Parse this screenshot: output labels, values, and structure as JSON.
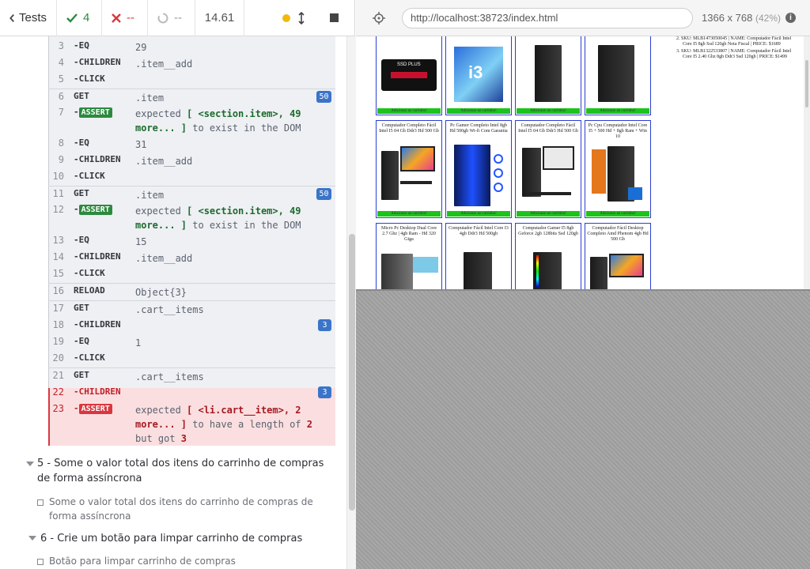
{
  "topbar": {
    "tests_label": "Tests",
    "passed": "4",
    "failed": "--",
    "pending": "--",
    "duration": "14.61"
  },
  "aut": {
    "url": "http://localhost:38723/index.html",
    "viewport": "1366 x 768",
    "scale": "(42%)"
  },
  "commands": [
    {
      "n": "3",
      "name": "-EQ",
      "msg": "29"
    },
    {
      "n": "4",
      "name": "-CHILDREN",
      "msg": ".item__add"
    },
    {
      "n": "5",
      "name": "-CLICK",
      "msg": ""
    },
    {
      "n": "6",
      "name": "GET",
      "msg": ".item",
      "badge": "50"
    },
    {
      "n": "7",
      "name": "ASSERT",
      "msg_a": "expected ",
      "msg_b": "[ <section.item>, 49 more... ]",
      "msg_c": " to exist in the DOM"
    },
    {
      "n": "8",
      "name": "-EQ",
      "msg": "31"
    },
    {
      "n": "9",
      "name": "-CHILDREN",
      "msg": ".item__add"
    },
    {
      "n": "10",
      "name": "-CLICK",
      "msg": ""
    },
    {
      "n": "11",
      "name": "GET",
      "msg": ".item",
      "badge": "50"
    },
    {
      "n": "12",
      "name": "ASSERT",
      "msg_a": "expected ",
      "msg_b": "[ <section.item>, 49 more... ]",
      "msg_c": " to exist in the DOM"
    },
    {
      "n": "13",
      "name": "-EQ",
      "msg": "15"
    },
    {
      "n": "14",
      "name": "-CHILDREN",
      "msg": ".item__add"
    },
    {
      "n": "15",
      "name": "-CLICK",
      "msg": ""
    },
    {
      "n": "16",
      "name": "RELOAD",
      "msg": "Object{3}"
    },
    {
      "n": "17",
      "name": "GET",
      "msg": ".cart__items"
    },
    {
      "n": "18",
      "name": "-CHILDREN",
      "msg": "",
      "badge": "3"
    },
    {
      "n": "19",
      "name": "-EQ",
      "msg": "1"
    },
    {
      "n": "20",
      "name": "-CLICK",
      "msg": ""
    },
    {
      "n": "21",
      "name": "GET",
      "msg": ".cart__items"
    },
    {
      "n": "22",
      "name": "-CHILDREN",
      "msg": "",
      "badge": "3"
    },
    {
      "n": "23",
      "name": "ASSERT",
      "msg_a": "expected ",
      "msg_b": "[ <li.cart__item>, 2 more... ]",
      "msg_c": " to have a length of ",
      "msg_d": "2",
      "msg_e": "but got ",
      "msg_f": "3"
    }
  ],
  "suites": [
    {
      "title": "5 - Some o valor total dos itens do carrinho de compras de forma assíncrona",
      "test": "Some o valor total dos itens do carrinho de compras de forma assíncrona"
    },
    {
      "title": "6 - Crie um botão para limpar carrinho de compras",
      "test": "Botão para limpar carrinho de compras"
    }
  ],
  "products": [
    {
      "title": "",
      "btn": "Adicionar ao carrinho!"
    },
    {
      "title": "",
      "btn": "Adicionar ao carrinho!"
    },
    {
      "title": "",
      "btn": "Adicionar ao carrinho!"
    },
    {
      "title": "",
      "btn": "Adicionar ao carrinho!"
    },
    {
      "title": "Computador Completo Fácil Intel I5 04 Gb Ddr3 Hd 500 Gb",
      "btn": "Adicionar ao carrinho!"
    },
    {
      "title": "Pc Gamer Completo Intel 8gb Hd 500gb Wi-fi Com Garantia",
      "btn": "Adicionar ao carrinho!"
    },
    {
      "title": "Computador Completo Fácil Intel I5 04 Gb Ddr3 Hd 500 Gb",
      "btn": "Adicionar ao carrinho!"
    },
    {
      "title": "Pc Cpu Computador Intel Core I5 + 500 Hd + 8gb Ram + Win 10",
      "btn": "Adicionar ao carrinho!"
    },
    {
      "title": "Micro Pc Desktop Dual Core 2.7 Ghz | 4gb Ram - Hd 320 Giga",
      "btn": ""
    },
    {
      "title": "Computador Fácil Intel Core I3 4gb Ddr3 Hd 500gb",
      "btn": ""
    },
    {
      "title": "Computador Gamer I5 8gb Geforce 2gb 128bits Ssd 120gb",
      "btn": ""
    },
    {
      "title": "Computador Fácil Desktop Completo Amd Phenom 4gb Hd 500 Gb",
      "btn": ""
    }
  ],
  "cart_items": [
    "SKU: MLB1473050045 | NAME: Computador Fácil Intel Core I5 8gb Ssd 120gb Nota Fiscal | PRICE: $1689",
    "SKU: MLB1322533807 | NAME: Computador Fácil Intel Core I5 2.40 Ghz 8gb Ddr3 Ssd 120gb | PRICE: $1499"
  ],
  "colors": {
    "pass": "#2b8a3e",
    "fail": "#d9373f",
    "badge": "#3b74c9",
    "card_border": "#2a3fd0",
    "add_button": "#1bc41b"
  }
}
